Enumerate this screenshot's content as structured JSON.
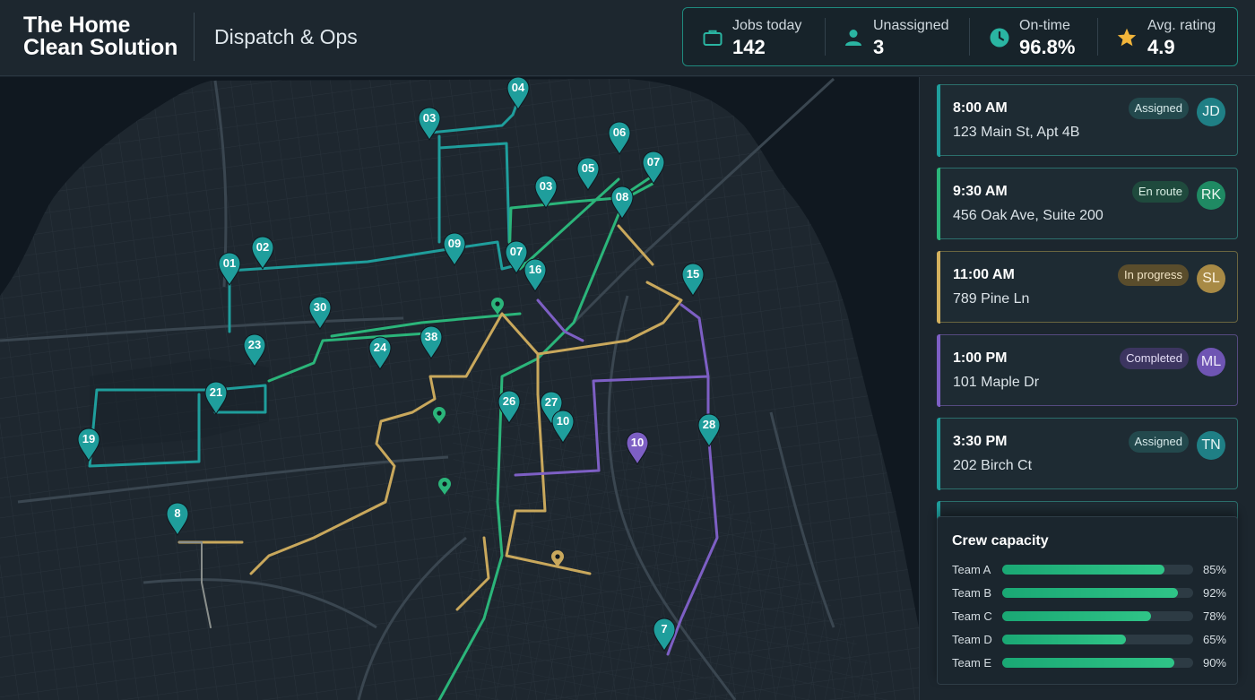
{
  "brand": {
    "line1": "The Home",
    "line2": "Clean Solution"
  },
  "section_title": "Dispatch & Ops",
  "stats": [
    {
      "icon": "briefcase-icon",
      "label": "Jobs today",
      "value": "142"
    },
    {
      "icon": "person-icon",
      "label": "Unassigned",
      "value": "3"
    },
    {
      "icon": "clock-icon",
      "label": "On-time",
      "value": "96.8%"
    },
    {
      "icon": "star-icon",
      "label": "Avg. rating",
      "value": "4.9"
    }
  ],
  "jobs": [
    {
      "time": "8:00 AM",
      "address": "123 Main St, Apt 4B",
      "status": "Assigned",
      "initials": "JD"
    },
    {
      "time": "9:30 AM",
      "address": "456 Oak Ave, Suite 200",
      "status": "En route",
      "initials": "RK"
    },
    {
      "time": "11:00 AM",
      "address": "789 Pine Ln",
      "status": "In progress",
      "initials": "SL"
    },
    {
      "time": "1:00 PM",
      "address": "101 Maple Dr",
      "status": "Completed",
      "initials": "ML"
    },
    {
      "time": "3:30 PM",
      "address": "202 Birch Ct",
      "status": "Assigned",
      "initials": "TN"
    }
  ],
  "capacity": {
    "title": "Crew capacity",
    "teams": [
      {
        "name": "Team A",
        "percent": 85,
        "label": "85%"
      },
      {
        "name": "Team B",
        "percent": 92,
        "label": "92%"
      },
      {
        "name": "Team C",
        "percent": 78,
        "label": "78%"
      },
      {
        "name": "Team D",
        "percent": 65,
        "label": "65%"
      },
      {
        "name": "Team E",
        "percent": 90,
        "label": "90%"
      }
    ]
  },
  "map_pins": [
    {
      "label": "04",
      "color": "teal"
    },
    {
      "label": "03",
      "color": "teal"
    },
    {
      "label": "06",
      "color": "teal"
    },
    {
      "label": "05",
      "color": "teal"
    },
    {
      "label": "07",
      "color": "teal"
    },
    {
      "label": "03",
      "color": "teal"
    },
    {
      "label": "08",
      "color": "teal"
    },
    {
      "label": "02",
      "color": "teal"
    },
    {
      "label": "01",
      "color": "teal"
    },
    {
      "label": "09",
      "color": "teal"
    },
    {
      "label": "07",
      "color": "teal"
    },
    {
      "label": "16",
      "color": "teal"
    },
    {
      "label": "15",
      "color": "teal"
    },
    {
      "label": "30",
      "color": "teal"
    },
    {
      "label": "23",
      "color": "teal"
    },
    {
      "label": "24",
      "color": "teal"
    },
    {
      "label": "38",
      "color": "teal"
    },
    {
      "label": "21",
      "color": "teal"
    },
    {
      "label": "19",
      "color": "teal"
    },
    {
      "label": "26",
      "color": "teal"
    },
    {
      "label": "27",
      "color": "teal"
    },
    {
      "label": "10",
      "color": "teal"
    },
    {
      "label": "10",
      "color": "purple"
    },
    {
      "label": "28",
      "color": "teal"
    },
    {
      "label": "8",
      "color": "teal"
    },
    {
      "label": "7",
      "color": "teal"
    }
  ],
  "colors": {
    "teal": "#1f9e9c",
    "green": "#2bb57a",
    "yellow": "#c9a85c",
    "purple": "#7d5fc4",
    "accent_border": "#1f8a7e"
  }
}
